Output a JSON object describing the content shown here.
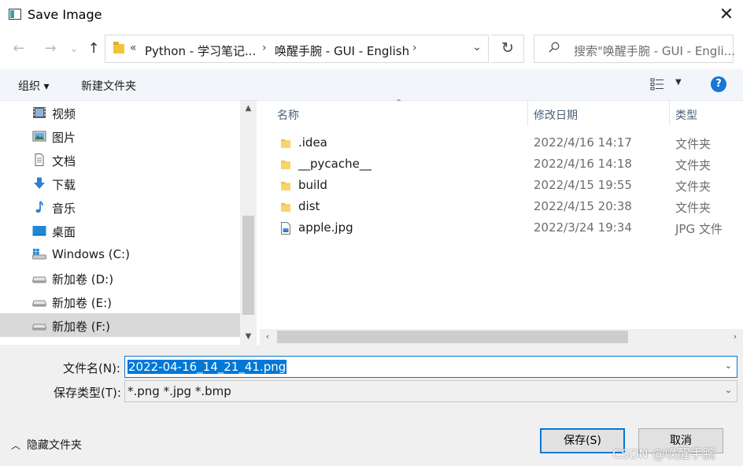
{
  "window": {
    "title": "Save Image",
    "close_glyph": "✕"
  },
  "nav": {
    "back_glyph": "←",
    "forward_glyph": "→",
    "history_glyph": "⌄",
    "up_glyph": "↑",
    "address": {
      "overflow": "«",
      "parts": [
        "Python - 学习笔记...",
        "唤醒手腕 - GUI - English"
      ],
      "separator": "›",
      "dropdown_glyph": "⌄"
    },
    "refresh_glyph": "↻",
    "search_placeholder": "搜索\"唤醒手腕 - GUI - Engli..."
  },
  "toolbar": {
    "organize_label": "组织 ▾",
    "new_folder_label": "新建文件夹",
    "help_label": "?",
    "view_dropdown_glyph": "▼"
  },
  "sidebar": {
    "items": [
      {
        "label": "视频",
        "icon": "video-icon"
      },
      {
        "label": "图片",
        "icon": "pictures-icon"
      },
      {
        "label": "文档",
        "icon": "documents-icon"
      },
      {
        "label": "下载",
        "icon": "download-icon"
      },
      {
        "label": "音乐",
        "icon": "music-icon"
      },
      {
        "label": "桌面",
        "icon": "desktop-icon"
      },
      {
        "label": "Windows  (C:)",
        "icon": "windows-drive-icon"
      },
      {
        "label": "新加卷 (D:)",
        "icon": "drive-icon"
      },
      {
        "label": "新加卷 (E:)",
        "icon": "drive-icon"
      },
      {
        "label": "新加卷 (F:)",
        "icon": "drive-icon",
        "selected": true
      }
    ],
    "scroll_up_glyph": "▲",
    "scroll_down_glyph": "▼"
  },
  "files": {
    "columns": [
      "名称",
      "修改日期",
      "类型"
    ],
    "sort_glyph": "⌃",
    "rows": [
      {
        "name": ".idea",
        "date": "2022/4/16 14:17",
        "type": "文件夹",
        "icon": "folder-icon"
      },
      {
        "name": "__pycache__",
        "date": "2022/4/16 14:18",
        "type": "文件夹",
        "icon": "folder-icon"
      },
      {
        "name": "build",
        "date": "2022/4/15 19:55",
        "type": "文件夹",
        "icon": "folder-icon"
      },
      {
        "name": "dist",
        "date": "2022/4/15 20:38",
        "type": "文件夹",
        "icon": "folder-icon"
      },
      {
        "name": "apple.jpg",
        "date": "2022/3/24 19:34",
        "type": "JPG 文件",
        "icon": "image-file-icon"
      }
    ],
    "scroll_left_glyph": "‹",
    "scroll_right_glyph": "›"
  },
  "form": {
    "filename_label": "文件名(N):",
    "filename_value": "2022-04-16_14_21_41.png",
    "filetype_label": "保存类型(T):",
    "filetype_value": "*.png *.jpg *.bmp",
    "dropdown_glyph": "⌄"
  },
  "footer": {
    "hide_folders_caret": "︿",
    "hide_folders_label": "隐藏文件夹",
    "save_label": "保存(S)",
    "cancel_label": "取消"
  },
  "watermark": "CSDN @唤醒手腕",
  "colors": {
    "accent": "#0078d7",
    "toolbar_bg": "#f2f6fb",
    "folder": "#f0c53a",
    "help": "#1976d2"
  }
}
